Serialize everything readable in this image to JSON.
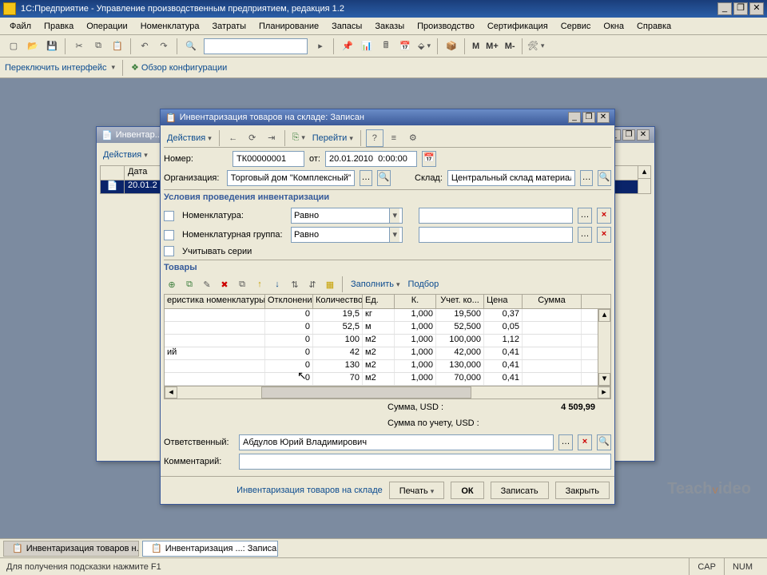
{
  "app": {
    "title": "1С:Предприятие - Управление производственным предприятием, редакция 1.2"
  },
  "menu": [
    "Файл",
    "Правка",
    "Операции",
    "Номенклатура",
    "Затраты",
    "Планирование",
    "Запасы",
    "Заказы",
    "Производство",
    "Сертификация",
    "Сервис",
    "Окна",
    "Справка"
  ],
  "toolbar2": {
    "switch_interface": "Переключить интерфейс",
    "config_overview": "Обзор конфигурации"
  },
  "bg_window": {
    "title": "Инвентар...",
    "actions": "Действия",
    "date_header": "Дата",
    "date_value": "20.01.2"
  },
  "dialog": {
    "title": "Инвентаризация товаров на складе: Записан",
    "actions": "Действия",
    "goto": "Перейти",
    "number_label": "Номер:",
    "number": "ТК00000001",
    "from_label": "от:",
    "date": "20.01.2010  0:00:00",
    "org_label": "Организация:",
    "org": "Торговый дом \"Комплексный\"",
    "wh_label": "Склад:",
    "wh": "Центральный склад материалов",
    "conditions_header": "Условия проведения инвентаризации",
    "nomen_label": "Номенклатура:",
    "nomen_op": "Равно",
    "nomen_group_label": "Номенклатурная группа:",
    "nomen_group_op": "Равно",
    "series_label": "Учитывать серии",
    "goods_header": "Товары",
    "fill": "Заполнить",
    "selection": "Подбор",
    "columns": [
      "еристика номенклатуры",
      "Отклонение",
      "Количество",
      "Ед.",
      "К.",
      "Учет. ко...",
      "Цена",
      "Сумма"
    ],
    "rows": [
      {
        "c0": "",
        "dev": "0",
        "qty": "19,5",
        "unit": "кг",
        "k": "1,000",
        "acc": "19,500",
        "price": "0,37",
        "sum": ""
      },
      {
        "c0": "",
        "dev": "0",
        "qty": "52,5",
        "unit": "м",
        "k": "1,000",
        "acc": "52,500",
        "price": "0,05",
        "sum": ""
      },
      {
        "c0": "",
        "dev": "0",
        "qty": "100",
        "unit": "м2",
        "k": "1,000",
        "acc": "100,000",
        "price": "1,12",
        "sum": ""
      },
      {
        "c0": "ий",
        "dev": "0",
        "qty": "42",
        "unit": "м2",
        "k": "1,000",
        "acc": "42,000",
        "price": "0,41",
        "sum": ""
      },
      {
        "c0": "",
        "dev": "0",
        "qty": "130",
        "unit": "м2",
        "k": "1,000",
        "acc": "130,000",
        "price": "0,41",
        "sum": ""
      },
      {
        "c0": "",
        "dev": "0",
        "qty": "70",
        "unit": "м2",
        "k": "1,000",
        "acc": "70,000",
        "price": "0,41",
        "sum": ""
      }
    ],
    "sum_label": "Сумма, USD :",
    "sum_value": "4 509,99",
    "sum_acc_label": "Сумма по учету, USD :",
    "sum_acc_value": "",
    "resp_label": "Ответственный:",
    "resp": "Абдулов Юрий Владимирович",
    "comment_label": "Комментарий:",
    "footer_link": "Инвентаризация товаров на складе",
    "print": "Печать",
    "ok": "ОК",
    "save": "Записать",
    "close": "Закрыть"
  },
  "taskbar": {
    "t1": "Инвентаризация товаров н...",
    "t2": "Инвентаризация ...: Записан"
  },
  "statusbar": {
    "hint": "Для получения подсказки нажмите F1",
    "cap": "CAP",
    "num": "NUM"
  }
}
